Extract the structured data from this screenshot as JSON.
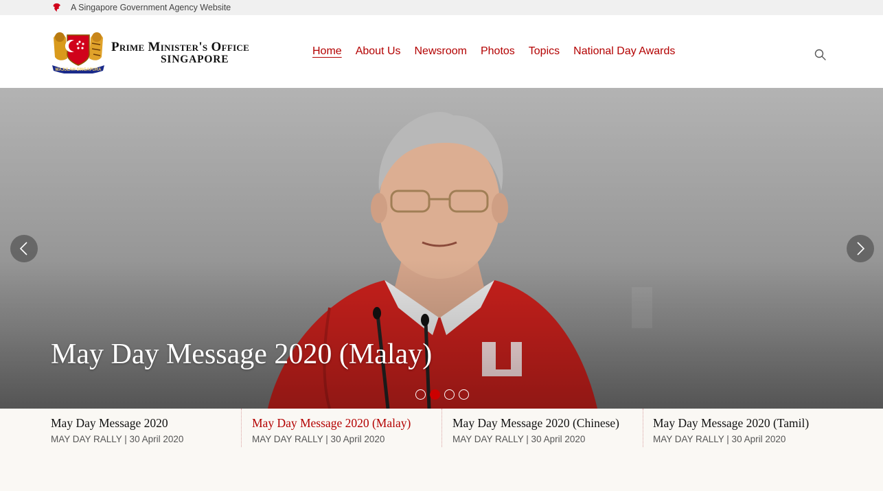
{
  "gov_banner": {
    "text": "A Singapore Government Agency Website",
    "icon": "lion-head-icon"
  },
  "header": {
    "logo_line1": "Prime Minister's Office",
    "logo_line2": "SINGAPORE",
    "crest_motto": "MAJULAH SINGAPURA",
    "nav": [
      {
        "label": "Home",
        "active": true
      },
      {
        "label": "About Us",
        "active": false
      },
      {
        "label": "Newsroom",
        "active": false
      },
      {
        "label": "Photos",
        "active": false
      },
      {
        "label": "Topics",
        "active": false
      },
      {
        "label": "National Day Awards",
        "active": false
      }
    ],
    "search_icon": "search-icon"
  },
  "hero": {
    "title": "May Day Message 2020 (Malay)",
    "prev_icon": "chevron-left-icon",
    "next_icon": "chevron-right-icon",
    "slide_count": 4,
    "active_slide": 2
  },
  "thumbnails": [
    {
      "title": "May Day Message 2020",
      "meta": "MAY DAY RALLY | 30 April 2020",
      "active": false
    },
    {
      "title": "May Day Message 2020 (Malay)",
      "meta": "MAY DAY RALLY | 30 April 2020",
      "active": true
    },
    {
      "title": "May Day Message 2020 (Chinese)",
      "meta": "MAY DAY RALLY | 30 April 2020",
      "active": false
    },
    {
      "title": "May Day Message 2020 (Tamil)",
      "meta": "MAY DAY RALLY | 30 April 2020",
      "active": false
    }
  ],
  "colors": {
    "accent": "#b30000",
    "dot_active": "#cc0000",
    "strip_bg": "#faf8f4"
  }
}
